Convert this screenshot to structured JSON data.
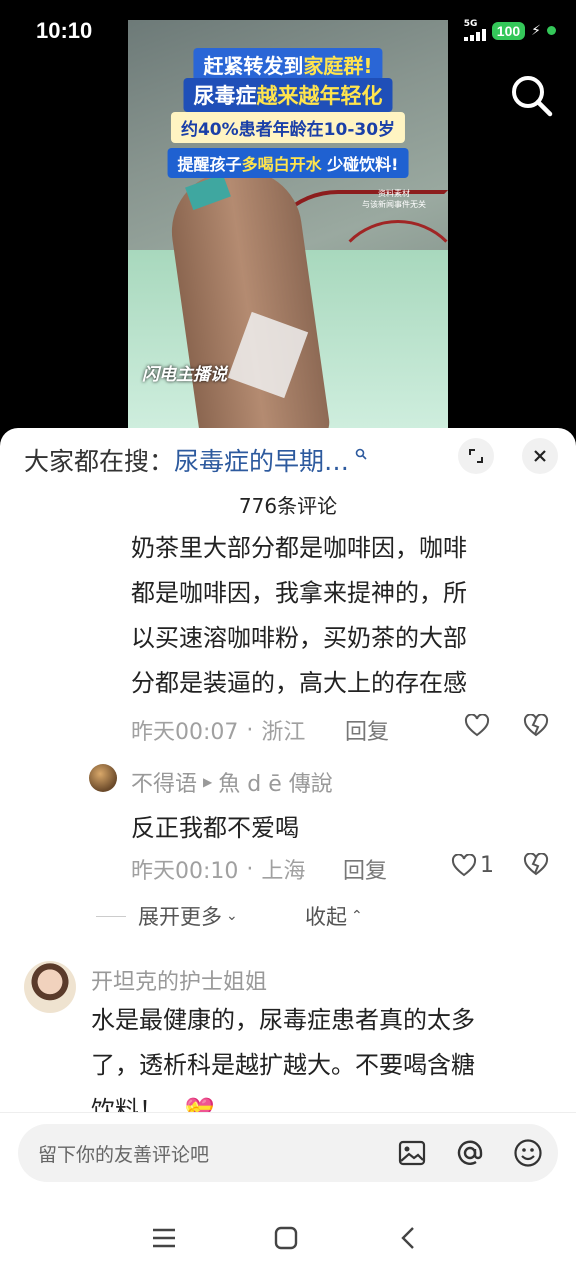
{
  "status_bar": {
    "time": "10:10",
    "network": "5G",
    "battery": "100"
  },
  "video": {
    "banner_line1_a": "赶紧转发到",
    "banner_line1_b": "家庭群!",
    "banner_line2_a": "尿毒症",
    "banner_line2_b": "越来越年轻化",
    "banner_line3": "约40%患者年龄在10-30岁",
    "banner_line4_a": "提醒孩子",
    "banner_line4_b": "多喝白开水",
    "banner_line4_c": " 少碰饮料!",
    "note_line1": "资料素材",
    "note_line2": "与该新闻事件无关",
    "logo": "闪电主播说"
  },
  "comment_sheet": {
    "search_prefix": "大家都在搜：",
    "search_query": "尿毒症的早期…",
    "count": "776条评论",
    "comments": [
      {
        "lines": [
          "奶茶里大部分都是咖啡因，咖啡",
          "都是咖啡因，我拿来提神的，所",
          "以买速溶咖啡粉，买奶茶的大部",
          "分都是装逼的，高大上的存在感"
        ],
        "time": "昨天00:07",
        "location": "浙江",
        "reply": "回复"
      },
      {
        "user": "不得语",
        "reply_to": "魚 d ē 傳說",
        "text": "反正我都不爱喝",
        "time": "昨天00:10",
        "location": "上海",
        "reply": "回复",
        "likes": "1"
      },
      {
        "user": "开坦克的护士姐姐",
        "lines": [
          "水是最健康的，尿毒症患者真的太多",
          "了，透析科是越扩越大。不要喝含糖",
          "饮料！"
        ]
      }
    ],
    "expand_more": "展开更多",
    "collapse": "收起",
    "dot_sep": "·"
  },
  "input": {
    "placeholder": "留下你的友善评论吧"
  },
  "colors": {
    "link_blue": "#2d5a9e",
    "battery_green": "#34c759"
  }
}
